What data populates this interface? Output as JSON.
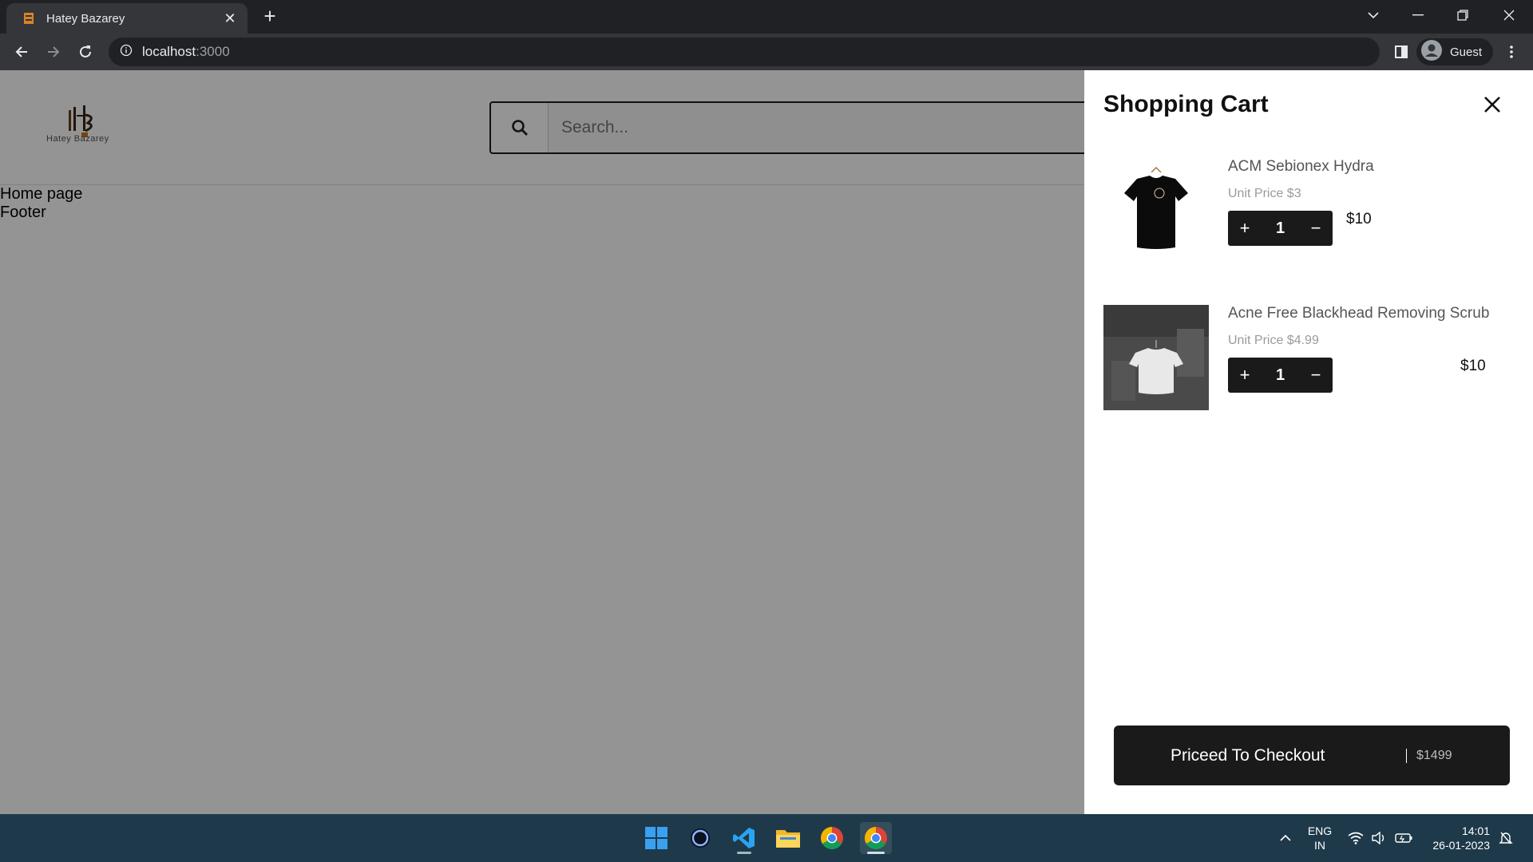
{
  "browser": {
    "tab_title": "Hatey Bazarey",
    "new_tab": "+",
    "address_host": "localhost",
    "address_port": ":3000",
    "profile_label": "Guest"
  },
  "page": {
    "logo_text": "Hatey Bazarey",
    "search_placeholder": "Search...",
    "home_text": "Home page",
    "footer_text": "Footer"
  },
  "cart": {
    "title": "Shopping Cart",
    "items": [
      {
        "name": "ACM Sebionex Hydra",
        "unit_price": "Unit Price $3",
        "quantity": "1",
        "price": "$10",
        "plus": "+",
        "minus": "−"
      },
      {
        "name": "Acne Free Blackhead Removing Scrub",
        "unit_price": "Unit Price $4.99",
        "quantity": "1",
        "price": "$10",
        "plus": "+",
        "minus": "−"
      }
    ],
    "checkout_label": "Priceed To Checkout",
    "checkout_total": "$1499"
  },
  "taskbar": {
    "lang_top": "ENG",
    "lang_bottom": "IN",
    "time": "14:01",
    "date": "26-01-2023",
    "apps": [
      "windows-start-icon",
      "cortana-icon",
      "vscode-icon",
      "file-explorer-icon",
      "chrome-icon",
      "chrome-icon"
    ]
  },
  "colors": {
    "chrome_dark": "#202124",
    "chrome_toolbar": "#35363a",
    "cart_button": "#1a1a1a",
    "taskbar": "#1e3a4a"
  }
}
